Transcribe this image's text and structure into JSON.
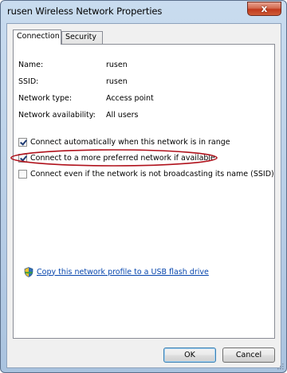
{
  "window": {
    "title": "rusen Wireless Network Properties",
    "close_glyph": "x"
  },
  "tabs": [
    {
      "label": "Connection",
      "active": true
    },
    {
      "label": "Security",
      "active": false
    }
  ],
  "info": [
    {
      "label": "Name:",
      "value": "rusen"
    },
    {
      "label": "SSID:",
      "value": "rusen"
    },
    {
      "label": "Network type:",
      "value": "Access point"
    },
    {
      "label": "Network availability:",
      "value": "All users"
    }
  ],
  "options": [
    {
      "label": "Connect automatically when this network is in range",
      "checked": true
    },
    {
      "label": "Connect to a more preferred network if available",
      "checked": true
    },
    {
      "label": "Connect even if the network is not broadcasting its name (SSID)",
      "checked": false
    }
  ],
  "link": {
    "text": "Copy this network profile to a USB flash drive",
    "icon": "shield-icon"
  },
  "buttons": {
    "ok": "OK",
    "cancel": "Cancel"
  },
  "colors": {
    "annotation": "#b0121c",
    "link": "#0645ad"
  }
}
